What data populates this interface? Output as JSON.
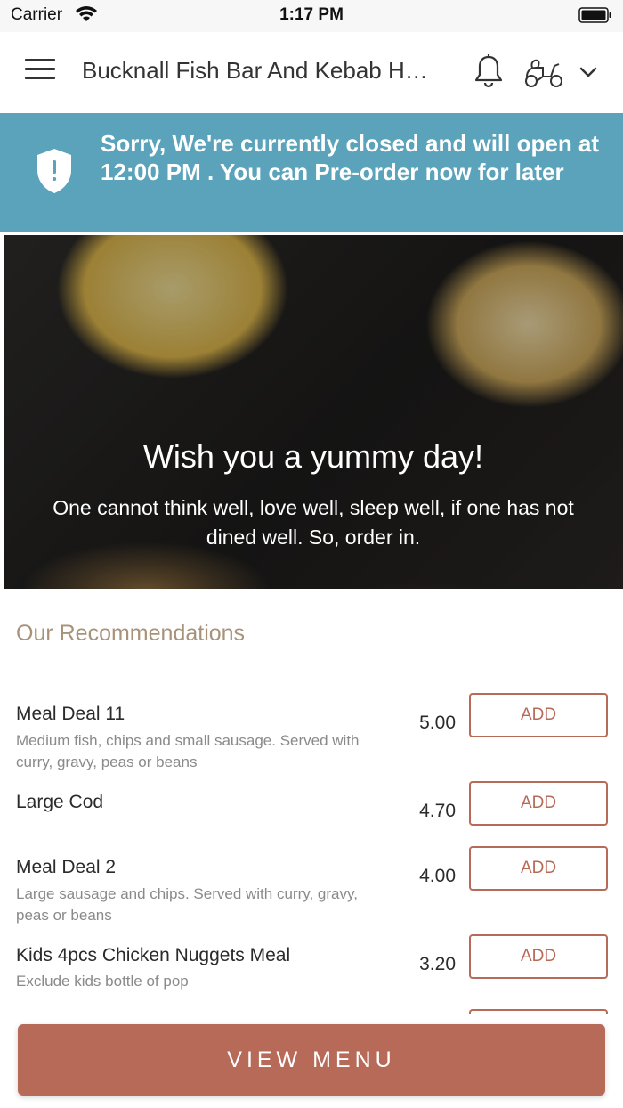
{
  "status_bar": {
    "carrier": "Carrier",
    "time": "1:17 PM"
  },
  "header": {
    "title": "Bucknall Fish Bar And Kebab House",
    "icons": [
      "menu-icon",
      "bell-icon",
      "scooter-icon",
      "chevron-down-icon"
    ]
  },
  "banner": {
    "message": "Sorry, We're currently closed and will open at 12:00 PM . You can Pre-order now for later",
    "icon": "shield-alert-icon",
    "color": "#5aa3bb"
  },
  "hero": {
    "title": "Wish you a yummy day!",
    "subtitle": "One cannot think well, love well, sleep well, if one has not dined well. So, order in."
  },
  "recommendations": {
    "title": "Our Recommendations",
    "items": [
      {
        "name": "Meal Deal 11",
        "description": "Medium fish, chips and small sausage. Served with curry, gravy, peas or beans",
        "price": "5.00",
        "button": "ADD"
      },
      {
        "name": "Large Cod",
        "description": "",
        "price": "4.70",
        "button": "ADD"
      },
      {
        "name": "Meal Deal 2",
        "description": "Large sausage and chips. Served with curry, gravy, peas or beans",
        "price": "4.00",
        "button": "ADD"
      },
      {
        "name": "Kids 4pcs Chicken Nuggets Meal",
        "description": "Exclude kids bottle of pop",
        "price": "3.20",
        "button": "ADD"
      }
    ]
  },
  "footer": {
    "view_menu_label": "VIEW MENU"
  },
  "colors": {
    "accent": "#b86a58",
    "section_title": "#a8927a",
    "banner": "#5aa3bb"
  }
}
